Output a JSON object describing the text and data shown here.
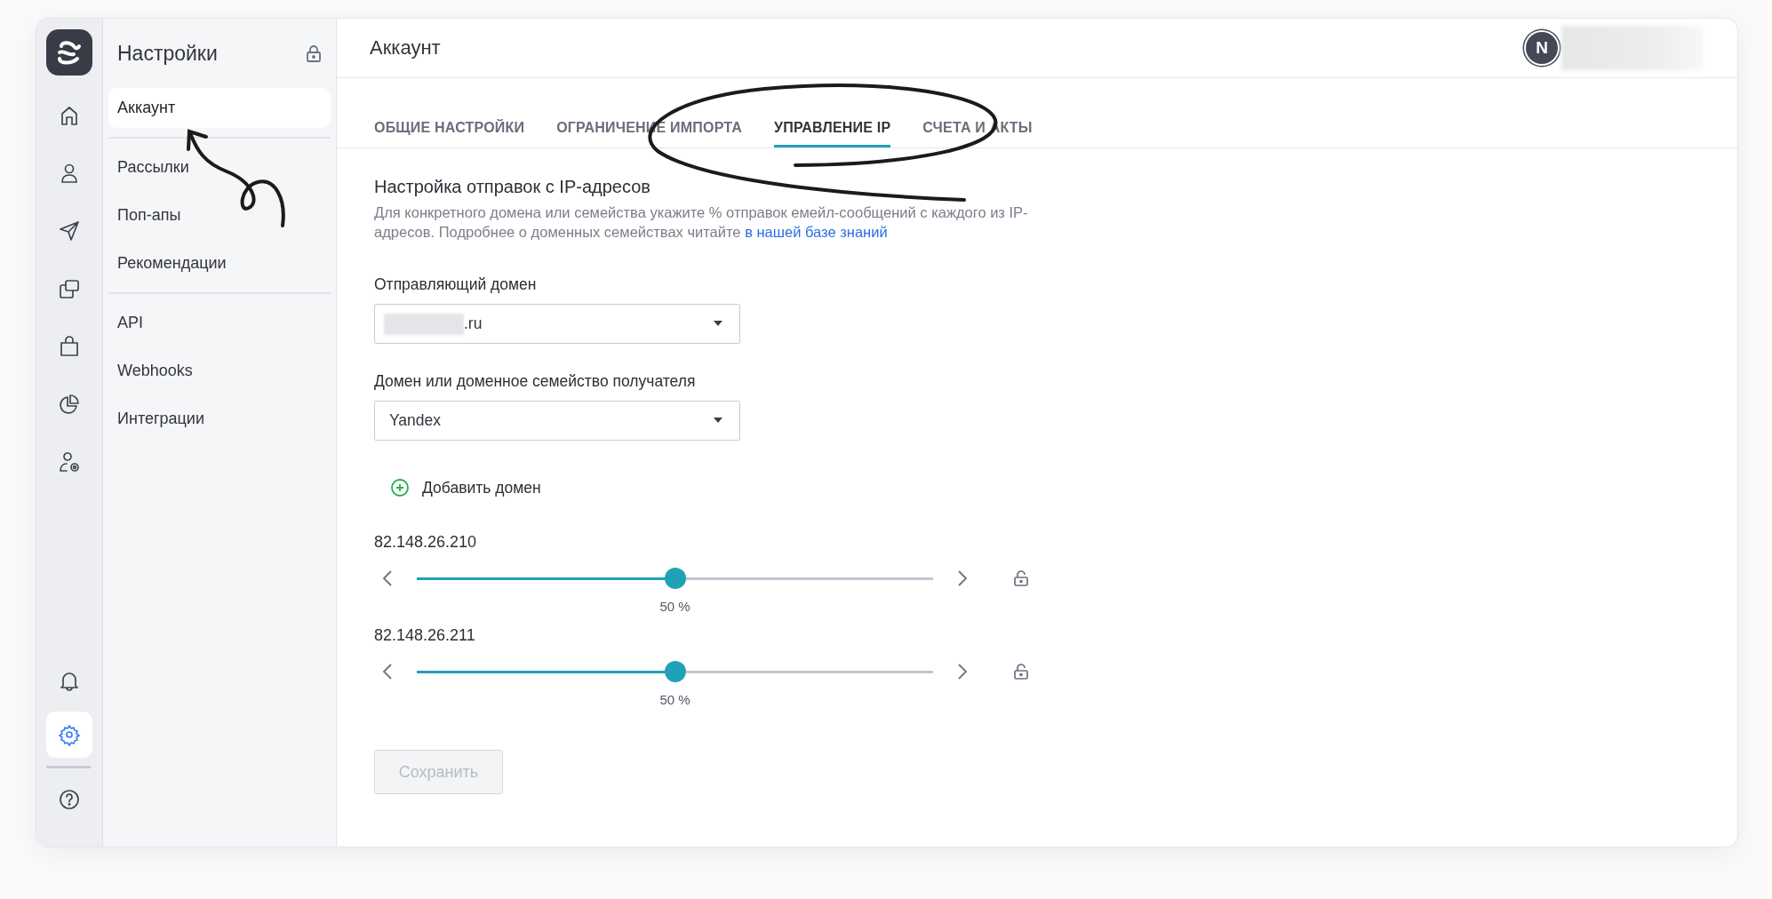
{
  "rail": {
    "top": [
      {
        "selected": false
      },
      {
        "selected": false
      },
      {
        "selected": false
      },
      {
        "selected": false
      },
      {
        "selected": false
      },
      {
        "selected": false
      },
      {
        "selected": false
      }
    ],
    "bottom": [
      {
        "selected": false
      },
      {
        "selected": true
      },
      {
        "selected": false
      }
    ]
  },
  "sidebar": {
    "title": "Настройки",
    "groups": [
      [
        {
          "label": "Аккаунт",
          "selected": true
        }
      ],
      [
        {
          "label": "Рассылки",
          "selected": false
        },
        {
          "label": "Поп-апы",
          "selected": false
        },
        {
          "label": "Рекомендации",
          "selected": false
        }
      ],
      [
        {
          "label": "API",
          "selected": false
        },
        {
          "label": "Webhooks",
          "selected": false
        },
        {
          "label": "Интеграции",
          "selected": false
        }
      ]
    ]
  },
  "header": {
    "title": "Аккаунт",
    "avatar": "N",
    "name_redacted": true
  },
  "tabs": [
    {
      "label": "ОБЩИЕ НАСТРОЙКИ",
      "selected": false
    },
    {
      "label": "ОГРАНИЧЕНИЕ ИМПОРТА",
      "selected": false
    },
    {
      "label": "УПРАВЛЕНИЕ IP",
      "selected": true
    },
    {
      "label": "СЧЕТА И АКТЫ",
      "selected": false
    }
  ],
  "section": {
    "title": "Настройка отправок с IP-адресов",
    "description": "Для конкретного домена или семейства укажите % отправок емейл-сообщений с каждого из IP-адресов. Подробнее о доменных семействах читайте",
    "link": "в нашей базе знаний"
  },
  "fields": [
    {
      "label": "Отправляющий домен",
      "value": ".ru",
      "redacted": true
    },
    {
      "label": "Домен или доменное семейство получателя",
      "value": "Yandex",
      "redacted": false
    }
  ],
  "add_domain": "Добавить домен",
  "ips": [
    {
      "address": "82.148.26.210",
      "level": 0.5,
      "reading": "50 %",
      "locked": false
    },
    {
      "address": "82.148.26.211",
      "level": 0.5,
      "reading": "50 %",
      "locked": false
    }
  ],
  "save": {
    "label": "Сохранить",
    "disabled": true
  }
}
